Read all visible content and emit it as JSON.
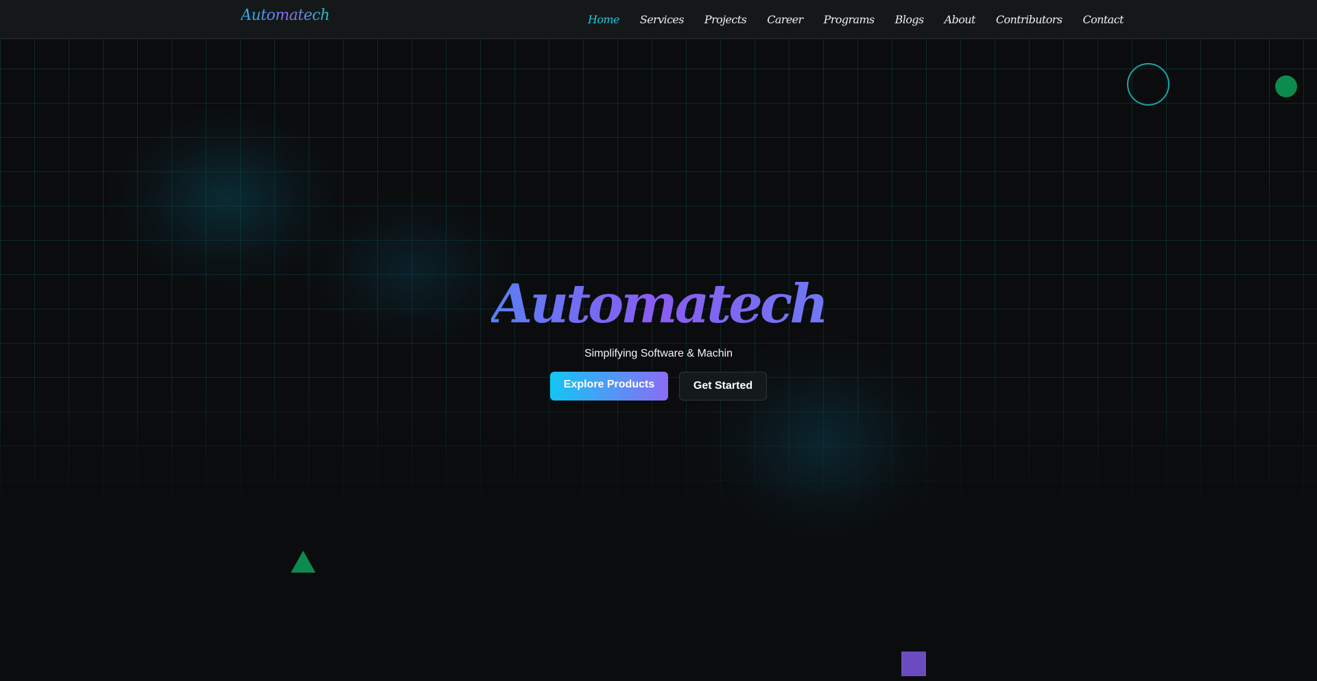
{
  "brand": {
    "name": "Automatech"
  },
  "nav": {
    "items": [
      {
        "label": "Home",
        "active": true
      },
      {
        "label": "Services",
        "active": false
      },
      {
        "label": "Projects",
        "active": false
      },
      {
        "label": "Career",
        "active": false
      },
      {
        "label": "Programs",
        "active": false
      },
      {
        "label": "Blogs",
        "active": false
      },
      {
        "label": "About",
        "active": false
      },
      {
        "label": "Contributors",
        "active": false
      },
      {
        "label": "Contact",
        "active": false
      }
    ]
  },
  "hero": {
    "title": "Automatech",
    "subtitle": "Simplifying Software & Machin",
    "primary_button": "Explore Products",
    "secondary_button": "Get Started"
  },
  "colors": {
    "accent_cyan": "#22c8e0",
    "accent_purple": "#8a5cf2",
    "background": "#0b0c0d",
    "grid_line": "#14969f",
    "shape_green": "#0d8a4e",
    "shape_purple": "#6a4cc0"
  }
}
